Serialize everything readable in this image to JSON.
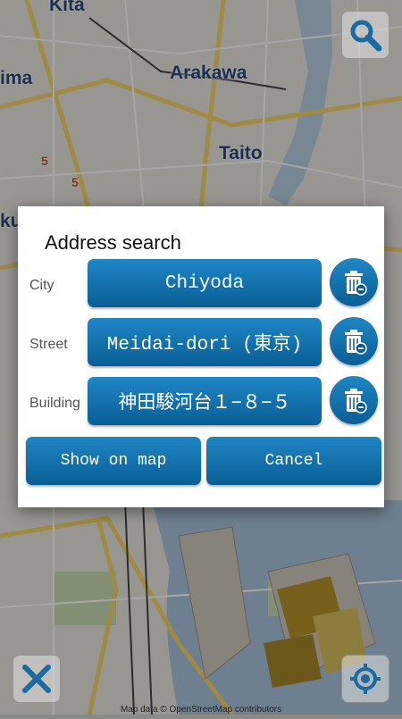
{
  "map": {
    "labels": [
      "Kita",
      "ima",
      "Arakawa",
      "Taito",
      "ku",
      "5",
      "5"
    ],
    "attribution": "Map data © OpenStreetMap contributors"
  },
  "dialog": {
    "title": "Address search",
    "rows": [
      {
        "label": "City",
        "value": "Chiyoda"
      },
      {
        "label": "Street",
        "value": "Meidai-dori (東京)"
      },
      {
        "label": "Building",
        "value": "神田駿河台１−８−５"
      }
    ],
    "show_on_map_label": "Show on map",
    "cancel_label": "Cancel"
  },
  "icons": {
    "search": "search-icon",
    "trash": "trash-icon",
    "tools": "tools-icon",
    "locate": "crosshair-icon"
  }
}
